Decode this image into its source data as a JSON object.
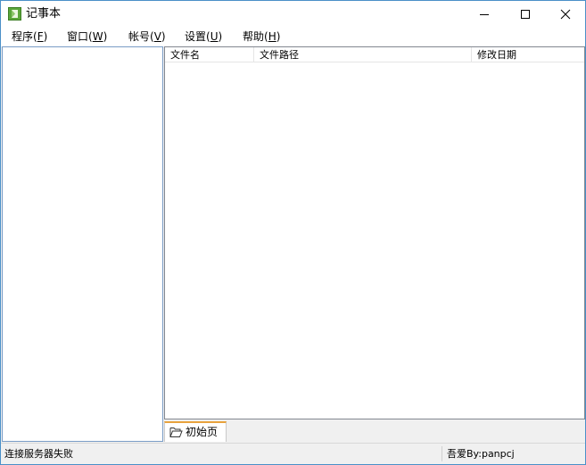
{
  "window": {
    "title": "记事本",
    "icon": "notepad-icon",
    "controls": [
      "minimize-icon",
      "maximize-icon",
      "close-icon"
    ]
  },
  "menu": {
    "items": [
      {
        "label": "程序(",
        "accel": "F",
        "tail": ")"
      },
      {
        "label": "窗口(",
        "accel": "W",
        "tail": ")"
      },
      {
        "label": "帐号(",
        "accel": "V",
        "tail": ")"
      },
      {
        "label": "设置(",
        "accel": "U",
        "tail": ")"
      },
      {
        "label": "帮助(",
        "accel": "H",
        "tail": ")"
      }
    ]
  },
  "file_list": {
    "columns": [
      "文件名",
      "文件路径",
      "修改日期"
    ],
    "rows": []
  },
  "tabs": [
    {
      "label": "初始页",
      "icon": "folder-open-icon",
      "active": true
    }
  ],
  "status": {
    "left": "连接服务器失败",
    "right": "吾爱By:panpcj"
  },
  "colors": {
    "window_border": "#4a90c8",
    "tab_accent": "#e8a33d",
    "app_icon_green": "#5aa63a"
  }
}
